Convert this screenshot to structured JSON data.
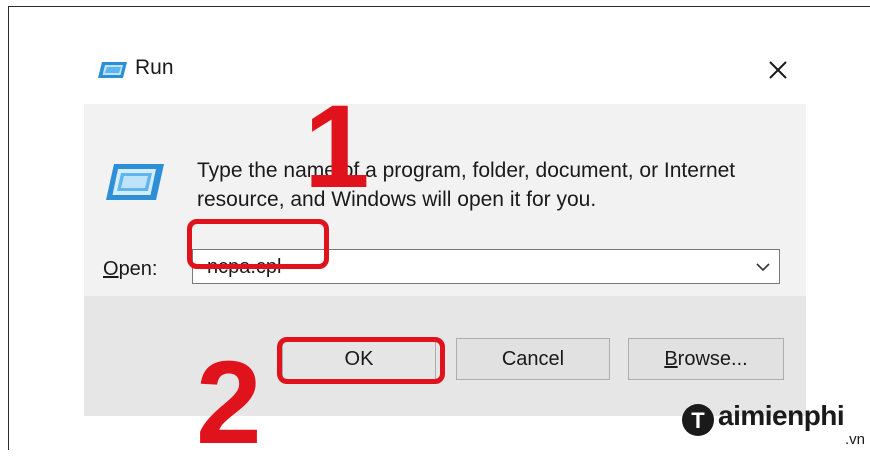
{
  "window": {
    "title": "Run",
    "close_glyph": "✕",
    "icon": "run-icon"
  },
  "content": {
    "description_line1": "Type the name of a program, folder, document, or Internet",
    "description_line2": "resource, and Windows will open it for you.",
    "open_label_prefix": "O",
    "open_label_rest": "pen:",
    "open_value": "ncpa.cpl",
    "dropdown_icon": "chevron-down-icon"
  },
  "buttons": {
    "ok": "OK",
    "cancel": "Cancel",
    "browse_prefix": "B",
    "browse_rest": "rowse..."
  },
  "annotations": {
    "step1": "1",
    "step2": "2",
    "color": "#e0121b"
  },
  "watermark": {
    "logo_letter": "T",
    "text": "aimienphi",
    "suffix": ".vn"
  }
}
